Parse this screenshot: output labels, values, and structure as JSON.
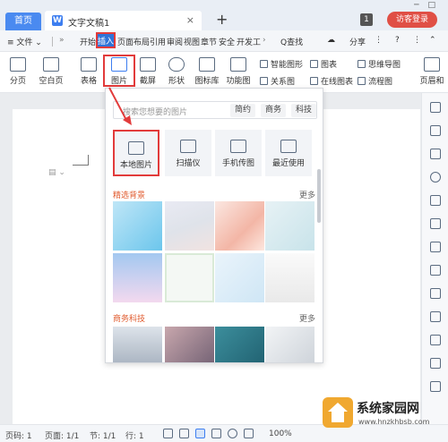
{
  "titlebar": {
    "home_tab": "首页",
    "doc_title": "文字文稿1",
    "close_glyph": "×",
    "new_tab_glyph": "+",
    "badge": "1",
    "login": "访客登录"
  },
  "menubar": {
    "file": "≡ 文件 ⌄",
    "start": "开始",
    "insert": "插入",
    "items": [
      "页面布局",
      "引用",
      "审阅",
      "视图",
      "章节",
      "安全",
      "开发工"
    ],
    "search": "Q查找",
    "share": "分享",
    "help": "?"
  },
  "ribbon": {
    "page_break": "分页",
    "blank_page": "空白页",
    "table": "表格",
    "picture": "图片",
    "screenshot": "截屏",
    "shape": "形状",
    "icon_lib": "图标库",
    "func_chart": "功能图",
    "smart_graphic": "智能图形",
    "chart": "图表",
    "mind_map": "思维导图",
    "relation": "关系图",
    "online_chart": "在线图表",
    "flowchart": "流程图",
    "header_footer": "页眉和"
  },
  "panel": {
    "search_placeholder": "搜索您想要的图片",
    "tags": [
      "简约",
      "商务",
      "科技"
    ],
    "tiles": [
      "本地图片",
      "扫描仪",
      "手机传图",
      "最近使用"
    ],
    "section1": "精选背景",
    "section2": "商务科技",
    "more": "更多"
  },
  "statusbar": {
    "page_no": "页码: 1",
    "pages": "页面: 1/1",
    "section": "节: 1/1",
    "row": "行: 1",
    "zoom": "100%"
  },
  "watermark": {
    "site_name": "系统家园网",
    "url": "www.hnzkhbsb.com"
  },
  "colors": {
    "accent": "#2f73d8",
    "highlight": "#e23b3b",
    "section_title": "#e05a2d"
  }
}
